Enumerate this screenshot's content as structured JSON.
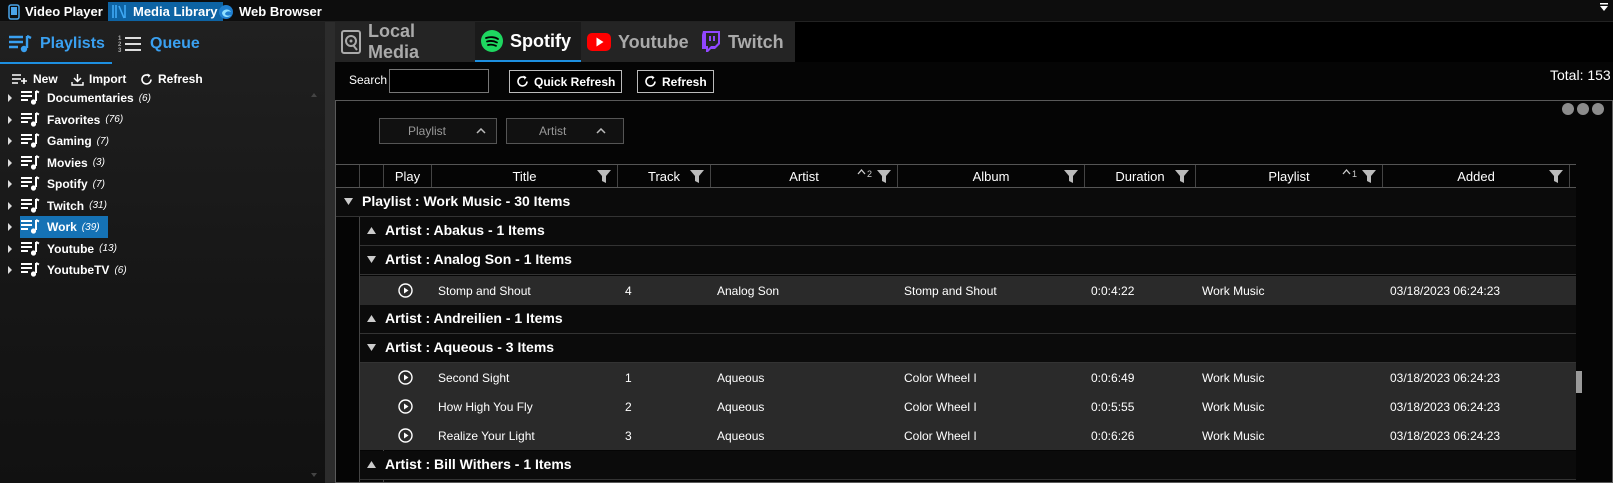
{
  "app_tabs": [
    {
      "label": "Video Player",
      "icon": "phone-icon",
      "active": false
    },
    {
      "label": "Media Library",
      "icon": "library-icon",
      "active": true
    },
    {
      "label": "Web Browser",
      "icon": "browser-icon",
      "active": false
    }
  ],
  "left": {
    "tabs": [
      {
        "label": "Playlists"
      },
      {
        "label": "Queue"
      }
    ],
    "actions": [
      {
        "label": "New"
      },
      {
        "label": "Import"
      },
      {
        "label": "Refresh"
      }
    ],
    "playlists": [
      {
        "name": "Documentaries",
        "count": "(6)"
      },
      {
        "name": "Favorites",
        "count": "(76)"
      },
      {
        "name": "Gaming",
        "count": "(7)"
      },
      {
        "name": "Movies",
        "count": "(3)"
      },
      {
        "name": "Spotify",
        "count": "(7)"
      },
      {
        "name": "Twitch",
        "count": "(31)"
      },
      {
        "name": "Work",
        "count": "(39)",
        "selected": true
      },
      {
        "name": "Youtube",
        "count": "(13)"
      },
      {
        "name": "YoutubeTV",
        "count": "(6)"
      }
    ]
  },
  "sources": [
    {
      "label": "Local Media",
      "icon": "local-media-icon"
    },
    {
      "label": "Spotify",
      "icon": "spotify-icon"
    },
    {
      "label": "Youtube",
      "icon": "youtube-icon"
    },
    {
      "label": "Twitch",
      "icon": "twitch-icon"
    }
  ],
  "search": {
    "label": "Search",
    "value": ""
  },
  "buttons": {
    "quick_refresh": "Quick Refresh",
    "refresh": "Refresh"
  },
  "total": "Total: 153",
  "group_chips": [
    {
      "label": "Playlist"
    },
    {
      "label": "Artist"
    }
  ],
  "columns": [
    {
      "label": "Play"
    },
    {
      "label": "Title"
    },
    {
      "label": "Track"
    },
    {
      "label": "Artist",
      "sort_order": "2"
    },
    {
      "label": "Album"
    },
    {
      "label": "Duration"
    },
    {
      "label": "Playlist",
      "sort_order": "1"
    },
    {
      "label": "Added"
    }
  ],
  "groups": {
    "playlist": "Playlist : Work Music - 30 Items",
    "abakus": "Artist : Abakus - 1 Items",
    "analog_son": "Artist : Analog Son - 1 Items",
    "andreilien": "Artist : Andreilien - 1 Items",
    "aqueous": "Artist : Aqueous - 3 Items",
    "bill_withers": "Artist : Bill Withers - 1 Items"
  },
  "rows": [
    {
      "title": "Stomp and Shout",
      "track": "4",
      "artist": "Analog Son",
      "album": "Stomp and Shout",
      "duration": "0:0:4:22",
      "playlist": "Work Music",
      "added": "03/18/2023 06:24:23"
    },
    {
      "title": "Second Sight",
      "track": "1",
      "artist": "Aqueous",
      "album": "Color Wheel I",
      "duration": "0:0:6:49",
      "playlist": "Work Music",
      "added": "03/18/2023 06:24:23"
    },
    {
      "title": "How High You Fly",
      "track": "2",
      "artist": "Aqueous",
      "album": "Color Wheel I",
      "duration": "0:0:5:55",
      "playlist": "Work Music",
      "added": "03/18/2023 06:24:23"
    },
    {
      "title": "Realize Your Light",
      "track": "3",
      "artist": "Aqueous",
      "album": "Color Wheel I",
      "duration": "0:0:6:26",
      "playlist": "Work Music",
      "added": "03/18/2023 06:24:23"
    }
  ],
  "colors": {
    "accent": "#1572b5",
    "spotify": "#1ed760",
    "youtube": "#ff0000",
    "twitch": "#9146ff"
  }
}
